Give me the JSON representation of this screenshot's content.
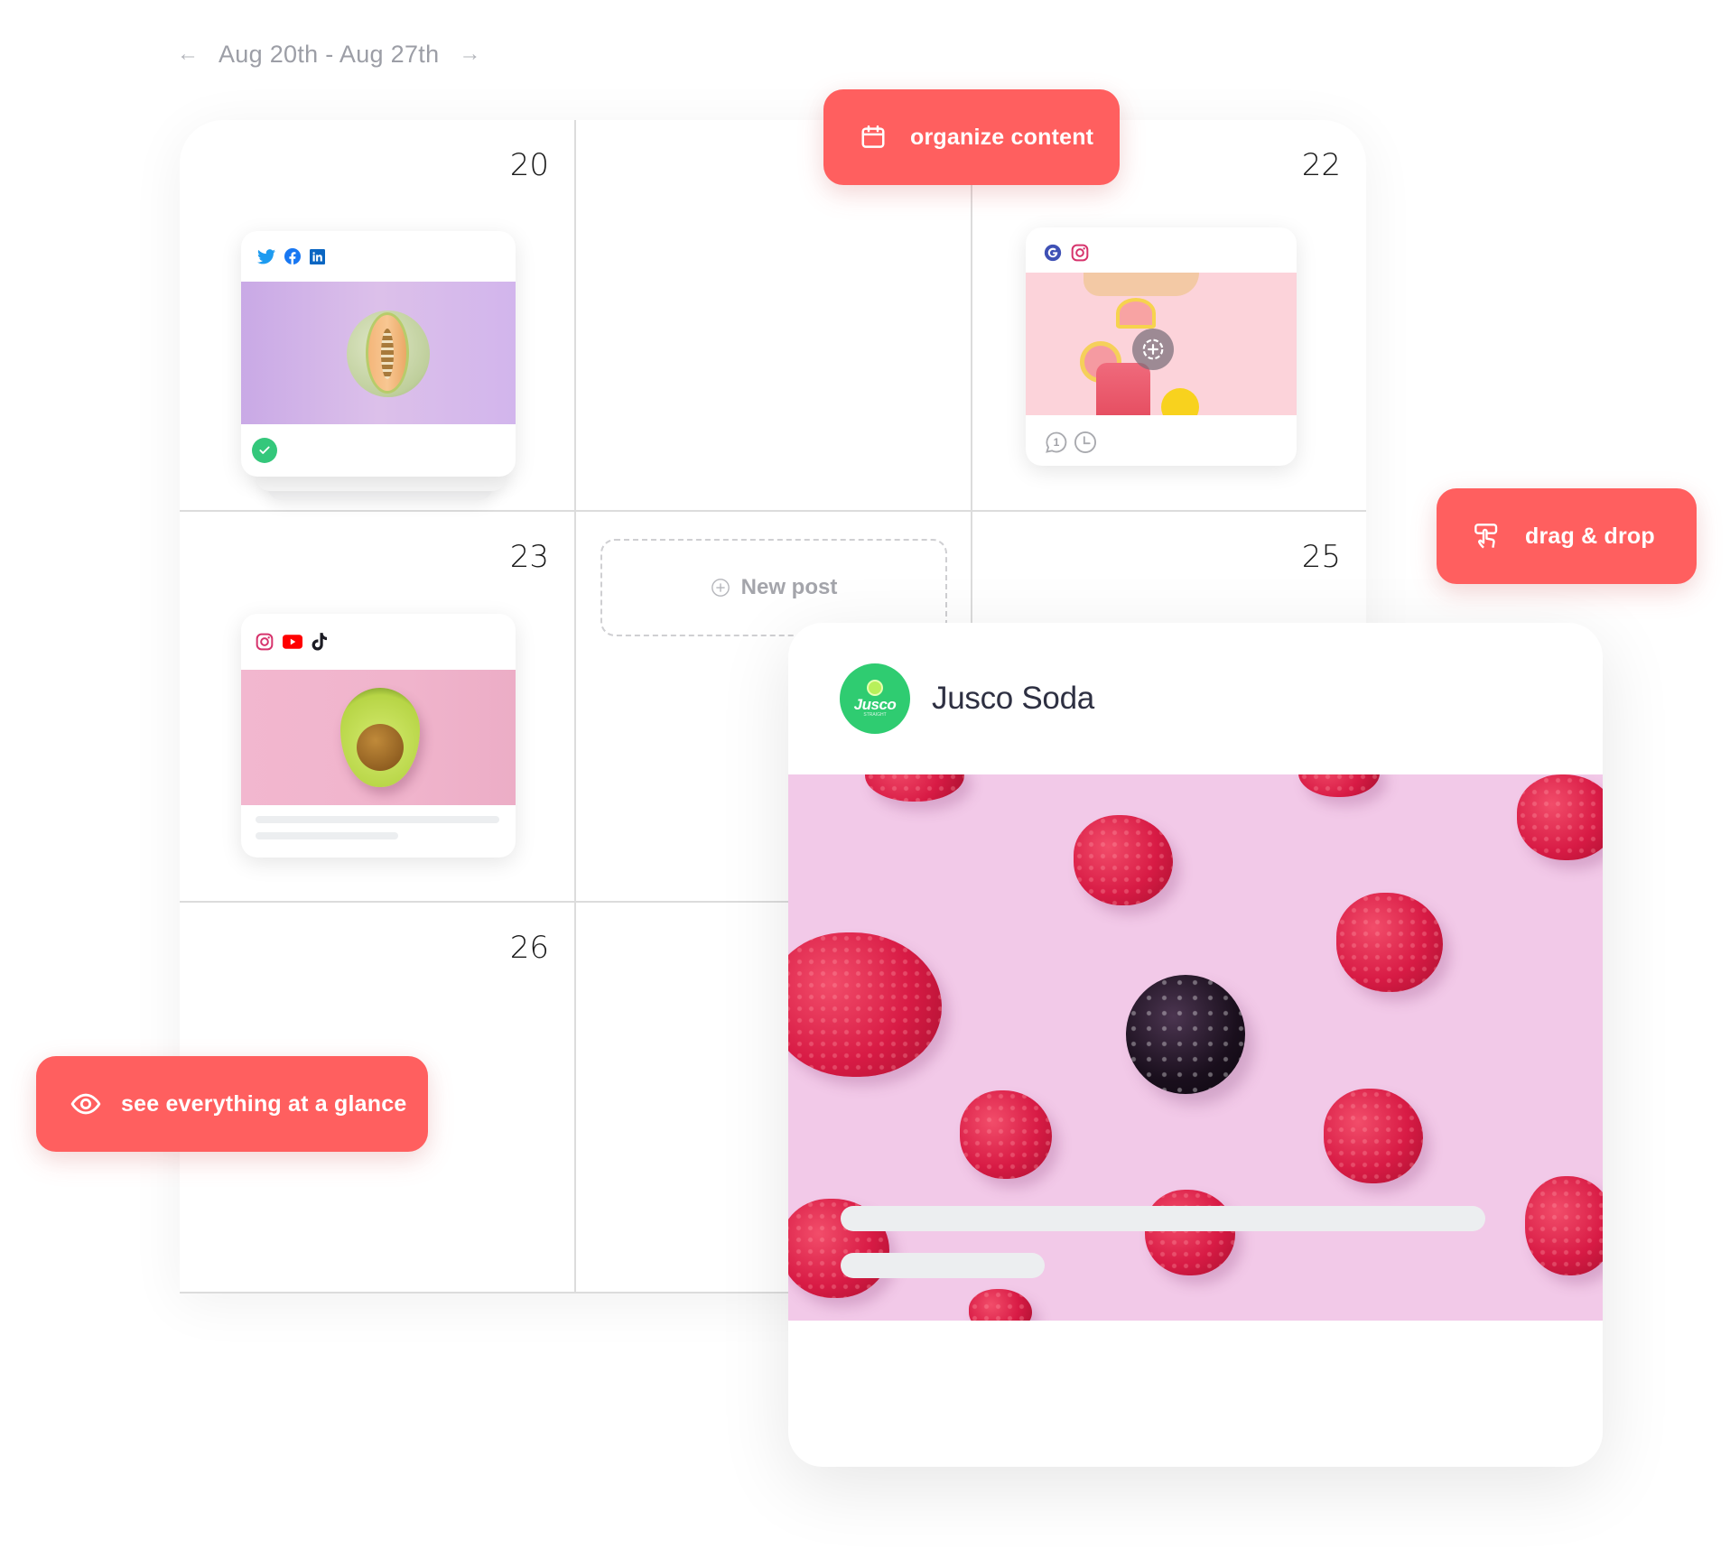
{
  "week_nav": {
    "prev_icon": "arrow-left-icon",
    "prev_glyph": "←",
    "range_label": "Aug 20th - Aug 27th",
    "next_icon": "arrow-right-icon",
    "next_glyph": "→"
  },
  "calendar": {
    "days": [
      "20",
      "",
      "22",
      "23",
      "",
      "25",
      "26",
      "",
      ""
    ]
  },
  "posts": {
    "aug20": {
      "networks": [
        "twitter-icon",
        "facebook-icon",
        "linkedin-icon"
      ],
      "image": "cantaloupe melon on lavender background",
      "status": "published",
      "status_icon": "check-circle-icon"
    },
    "aug22": {
      "networks": [
        "google-business-icon",
        "instagram-icon"
      ],
      "image": "grapefruit slices and pink drink on pink background",
      "overlay_icon": "add-media-icon",
      "comment_count": "1",
      "footer_icons": [
        "comment-icon",
        "clock-icon"
      ]
    },
    "aug23": {
      "networks": [
        "instagram-icon",
        "youtube-icon",
        "tiktok-icon"
      ],
      "image": "avocado half on pink background"
    }
  },
  "new_post": {
    "label": "New post",
    "icon": "plus-circle-icon"
  },
  "callouts": {
    "organize": {
      "label": "organize content",
      "icon": "calendar-icon"
    },
    "drag_drop": {
      "label": "drag & drop",
      "icon": "drag-hand-icon"
    },
    "glance": {
      "label": "see everything at a glance",
      "icon": "eye-icon"
    }
  },
  "preview_card": {
    "account_name": "Jusco Soda",
    "avatar_text": "Jusco",
    "avatar_subtext": "STRAIGHT",
    "image": "raspberries and a blackberry on pink background"
  },
  "colors": {
    "accent": "#ff5f5f",
    "published_green": "#2fcc71",
    "text_muted": "#9c9ea6",
    "grid_line": "#dcdcdc",
    "skeleton": "#eceef0"
  }
}
